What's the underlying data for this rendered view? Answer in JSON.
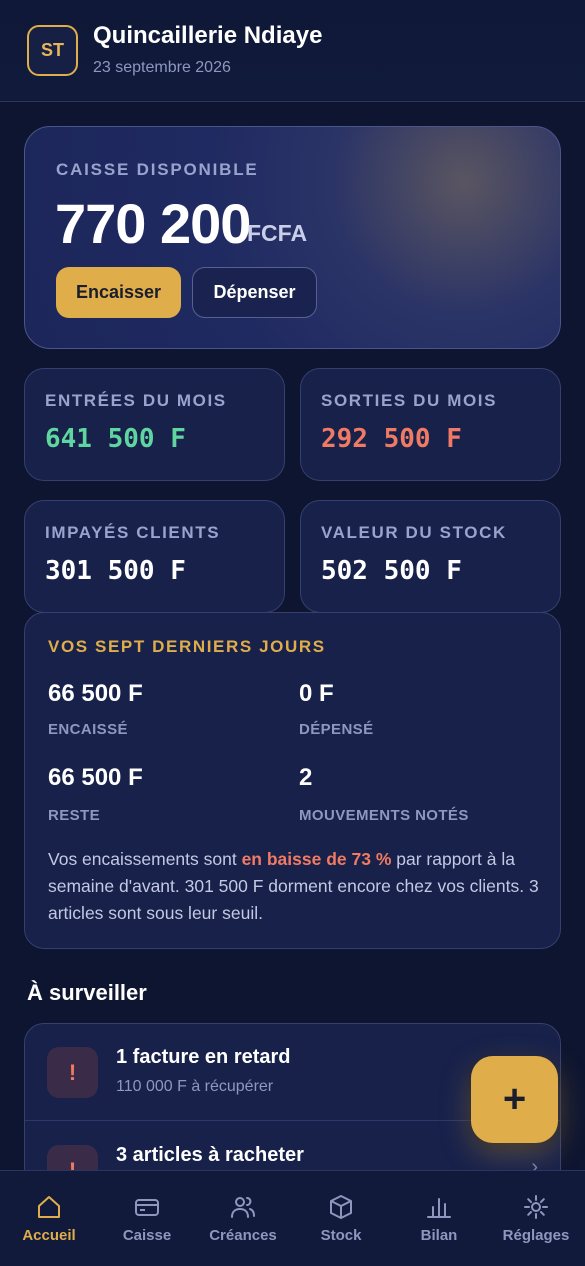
{
  "header": {
    "avatar_initials": "ST",
    "shop_name": "Quincaillerie Ndiaye",
    "date": "23 septembre 2026"
  },
  "cash": {
    "label": "CAISSE DISPONIBLE",
    "amount": "770 200",
    "currency": "FCFA",
    "encaisser_label": "Encaisser",
    "depenser_label": "Dépenser"
  },
  "stats": [
    {
      "label": "ENTRÉES DU MOIS",
      "value": "641 500 F",
      "color": "#5fd6a0"
    },
    {
      "label": "SORTIES DU MOIS",
      "value": "292 500 F",
      "color": "#f07a63"
    },
    {
      "label": "IMPAYÉS CLIENTS",
      "value": "301 500 F",
      "color": "#ffffff"
    },
    {
      "label": "VALEUR DU STOCK",
      "value": "502 500 F",
      "color": "#ffffff"
    }
  ],
  "week": {
    "title": "VOS SEPT DERNIERS JOURS",
    "encaisse_value": "66 500 F",
    "encaisse_label": "ENCAISSÉ",
    "depense_value": "0 F",
    "depense_label": "DÉPENSÉ",
    "reste_value": "66 500 F",
    "reste_label": "RESTE",
    "mouvements_value": "2",
    "mouvements_label": "MOUVEMENTS NOTÉS",
    "summary_prefix": "Vos encaissements sont ",
    "summary_highlight": "en baisse de 73 %",
    "summary_suffix": " par rapport à la semaine d'avant. 301 500 F dorment encore chez vos clients. 3 articles sont sous leur seuil."
  },
  "watch": {
    "title": "À surveiller",
    "items": [
      {
        "badge": "!",
        "title": "1 facture en retard",
        "subtitle": "110 000 F à récupérer"
      },
      {
        "badge": "!",
        "title": "3 articles à racheter",
        "subtitle": ""
      }
    ],
    "chevron": "›"
  },
  "fab_label": "+",
  "nav": {
    "items": [
      {
        "label": "Accueil",
        "icon": "home-icon",
        "active": true
      },
      {
        "label": "Caisse",
        "icon": "card-icon",
        "active": false
      },
      {
        "label": "Créances",
        "icon": "people-icon",
        "active": false
      },
      {
        "label": "Stock",
        "icon": "box-icon",
        "active": false
      },
      {
        "label": "Bilan",
        "icon": "chart-icon",
        "active": false
      },
      {
        "label": "Réglages",
        "icon": "gear-icon",
        "active": false
      }
    ]
  },
  "colors": {
    "accent": "#e0ad4b",
    "positive": "#5fd6a0",
    "negative": "#f07a63",
    "background": "#0e1530",
    "card": "#17214a"
  }
}
